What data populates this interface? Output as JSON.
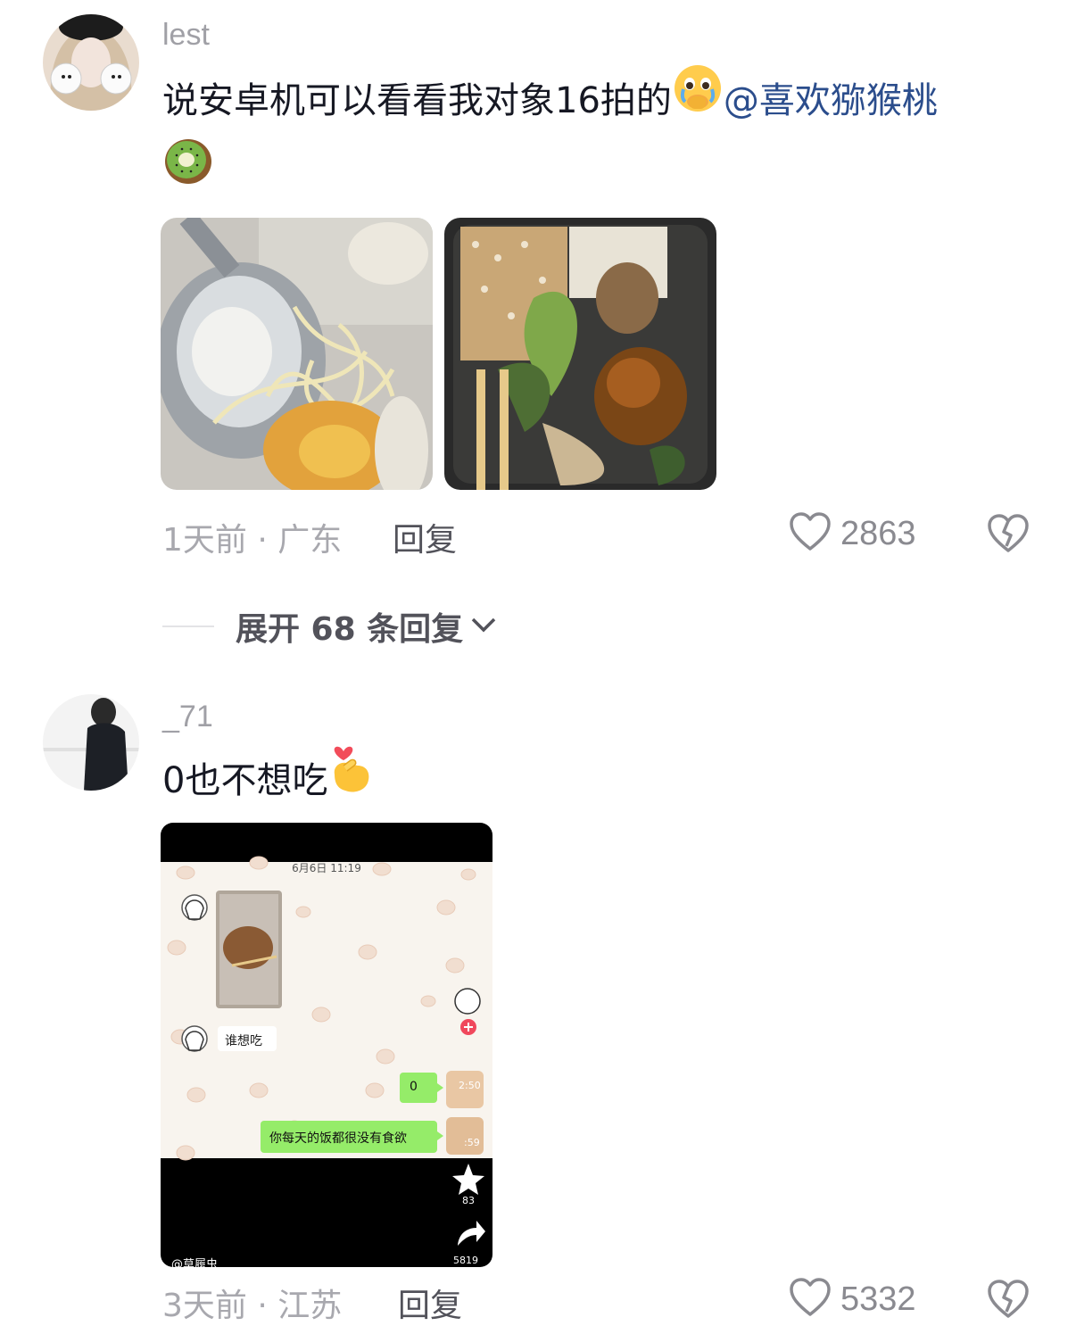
{
  "comments": [
    {
      "username": "lest",
      "text": "说安卓机可以看看我对象16拍的",
      "emoji_after_text": "crying-face-emoji",
      "mention": "@喜欢猕猴桃",
      "trailing_emoji": "kiwi-emoji",
      "images": [
        "noodle-soup-photo",
        "fried-rice-mushroom-photo"
      ],
      "time_location": "1天前 · 广东",
      "reply_label": "回复",
      "likes": "2863",
      "expand_label": "展开 68 条回复"
    },
    {
      "username": "_71",
      "text": "0也不想吃",
      "emoji_after_text": "finger-heart-emoji",
      "screenshot": {
        "timestamp": "6月6日 11:19",
        "msg_incoming": "谁想吃",
        "msg_out_1": "0",
        "msg_out_2": "你每天的饭都很没有食欲",
        "time_1": "2:50",
        "time_2": ":59",
        "star_count": "83",
        "share_count": "5819",
        "author_tag": "@草履虫"
      },
      "time_location": "3天前 · 江苏",
      "reply_label": "回复",
      "likes": "5332"
    }
  ],
  "colors": {
    "mention": "#2b4d8c",
    "bubble_green": "#95ec69",
    "text": "#161823",
    "meta": "#a8a8ae"
  }
}
